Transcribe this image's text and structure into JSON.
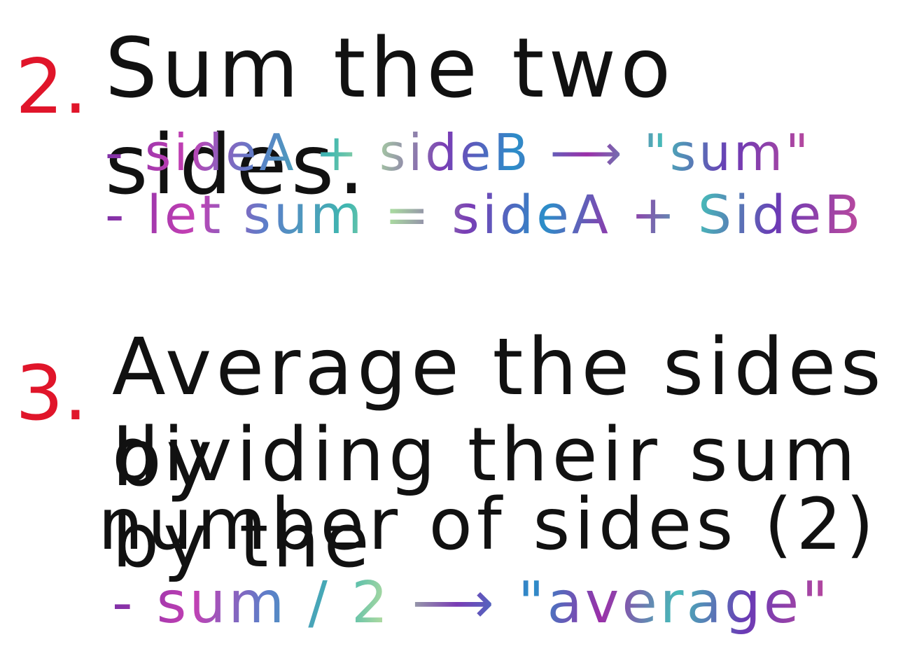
{
  "step2": {
    "number": "2.",
    "heading": "Sum the two sides.",
    "bullets": [
      "- sideA + sideB ⟶ \"sum\"",
      "- let sum = sideA + SideB"
    ]
  },
  "step3": {
    "number": "3.",
    "heading_lines": [
      "Average the sides by",
      "dividing their sum by the",
      "number of sides (2)"
    ],
    "bullets": [
      "- sum / 2 ⟶ \"average\""
    ]
  },
  "colors": {
    "number": "#e0152a",
    "heading": "#111111",
    "galaxy_accent": [
      "#7a2fa5",
      "#3fb7b0",
      "#c33fb3",
      "#2b8ec9"
    ]
  }
}
